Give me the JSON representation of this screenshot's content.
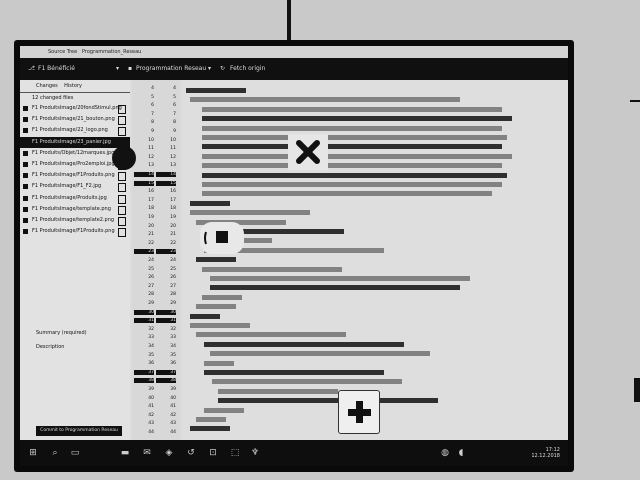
{
  "window": {
    "title": "Source Tree",
    "title_fragment": "Programmation_Reseau"
  },
  "toolbar": {
    "branch_label": "F1 Bénéficié",
    "repo_label": "Programmation Reseau",
    "fetch_label": "Fetch origin"
  },
  "panel": {
    "tab_changes": "Changes",
    "tab_history": "History",
    "changed_count": "12 changed files",
    "files": [
      {
        "name": "F1 ProduitsImage/20fondStimul.png"
      },
      {
        "name": "F1 ProduitsImage/21_bouton.png"
      },
      {
        "name": "F1 ProduitsImage/22_logo.png"
      },
      {
        "name": "F1 ProduitsImage/23_panier.jpg"
      },
      {
        "name": "F1 Produits/Objet/12marques.jpg"
      },
      {
        "name": "F1 ProduitsImage/Pro2emploi.jpg"
      },
      {
        "name": "F1 ProduitsImage/F1Produits.png"
      },
      {
        "name": "F1 ProduitsImage/F1_F2.jpg"
      },
      {
        "name": "F1 ProduitsImage/Produits.jpg"
      },
      {
        "name": "F1 ProduitsImage/template.png"
      },
      {
        "name": "F1 ProduitsImage/template2.png"
      },
      {
        "name": "F1 ProduitsImage/F1Produits.png"
      }
    ],
    "summary_label": "Summary (required)",
    "description_label": "Description",
    "commit_label": "Commit to Programmation Reseau"
  },
  "editor": {
    "line_numbers": [
      "4",
      "5",
      "6",
      "7",
      "8",
      "9",
      "10",
      "11",
      "12",
      "13",
      "14",
      "15",
      "16",
      "17",
      "18",
      "19",
      "20",
      "21",
      "22",
      "23",
      "24",
      "25",
      "26",
      "27",
      "28",
      "29",
      "30",
      "31",
      "32",
      "33",
      "34",
      "35",
      "36",
      "37",
      "38",
      "39",
      "40",
      "41",
      "42",
      "43",
      "44"
    ]
  },
  "taskbar": {
    "time": "17:12",
    "date": "12.12.2018"
  }
}
